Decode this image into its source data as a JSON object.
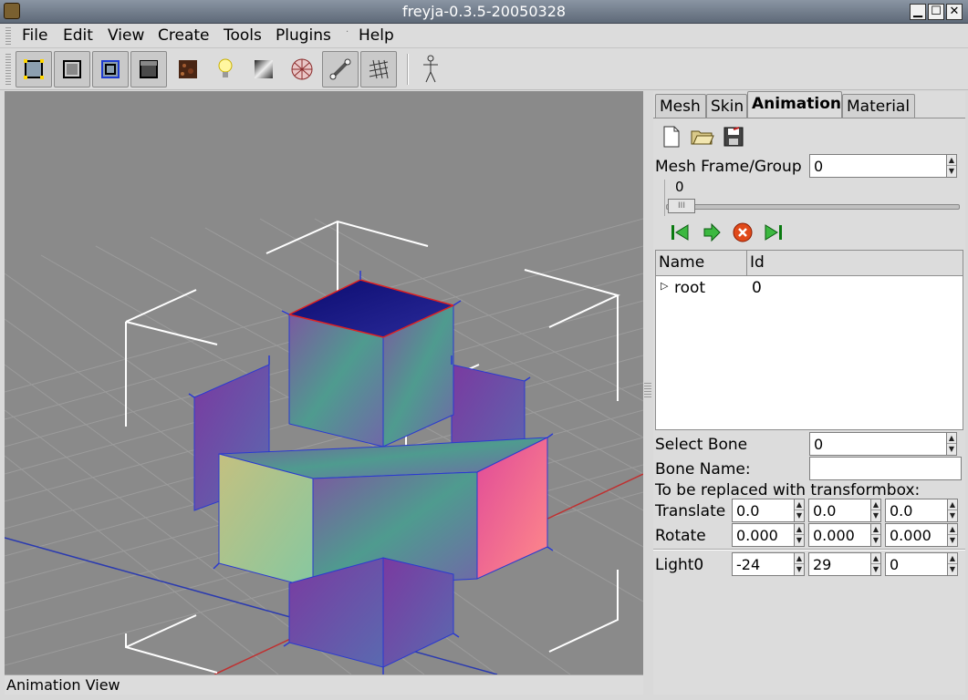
{
  "window": {
    "title": "freyja-0.3.5-20050328",
    "minimize": "▁",
    "maximize": "☐",
    "close": "✕"
  },
  "menu": {
    "items": [
      {
        "label": "File"
      },
      {
        "label": "Edit"
      },
      {
        "label": "View"
      },
      {
        "label": "Create"
      },
      {
        "label": "Tools"
      },
      {
        "label": "Plugins"
      },
      {
        "label": "Help"
      }
    ]
  },
  "toolbar": {
    "buttons": [
      {
        "icon": "vertex-select-icon",
        "pressed": true
      },
      {
        "icon": "face-select-icon",
        "pressed": true
      },
      {
        "icon": "edge-select-icon",
        "pressed": true
      },
      {
        "icon": "solid-shade-icon",
        "pressed": true
      },
      {
        "icon": "texture-icon",
        "pressed": false
      },
      {
        "icon": "light-bulb-icon",
        "pressed": false
      },
      {
        "icon": "material-icon",
        "pressed": false
      },
      {
        "icon": "wire-ball-icon",
        "pressed": false
      },
      {
        "icon": "bone-icon",
        "pressed": true
      },
      {
        "icon": "grid-icon",
        "pressed": true
      },
      {
        "icon": "skeleton-figure-icon",
        "pressed": false
      }
    ]
  },
  "statusbar": {
    "text": "Animation View"
  },
  "panel": {
    "tabs": [
      {
        "label": "Mesh",
        "active": false
      },
      {
        "label": "Skin",
        "active": false
      },
      {
        "label": "Animation",
        "active": true
      },
      {
        "label": "Material",
        "active": false
      }
    ],
    "file_buttons": [
      "new-file-icon",
      "open-folder-icon",
      "save-file-icon"
    ],
    "mesh_frame_label": "Mesh Frame/Group",
    "mesh_frame_value": "0",
    "slider_value_label": "0",
    "slider_fraction": 0.0,
    "playback_buttons": [
      "first-frame-icon",
      "play-icon",
      "stop-icon",
      "last-frame-icon"
    ],
    "tree": {
      "columns": [
        "Name",
        "Id"
      ],
      "rows": [
        {
          "name": "root",
          "id": "0"
        }
      ]
    },
    "select_bone_label": "Select Bone",
    "select_bone_value": "0",
    "bone_name_label": "Bone Name:",
    "bone_name_value": "",
    "transform_note": "To be replaced with transformbox:",
    "translate_label": "Translate",
    "translate": [
      "0.0",
      "0.0",
      "0.0"
    ],
    "rotate_label": "Rotate",
    "rotate": [
      "0.000",
      "0.000",
      "0.000"
    ],
    "light_label": "Light0",
    "light": [
      "-24",
      "29",
      "0"
    ]
  }
}
